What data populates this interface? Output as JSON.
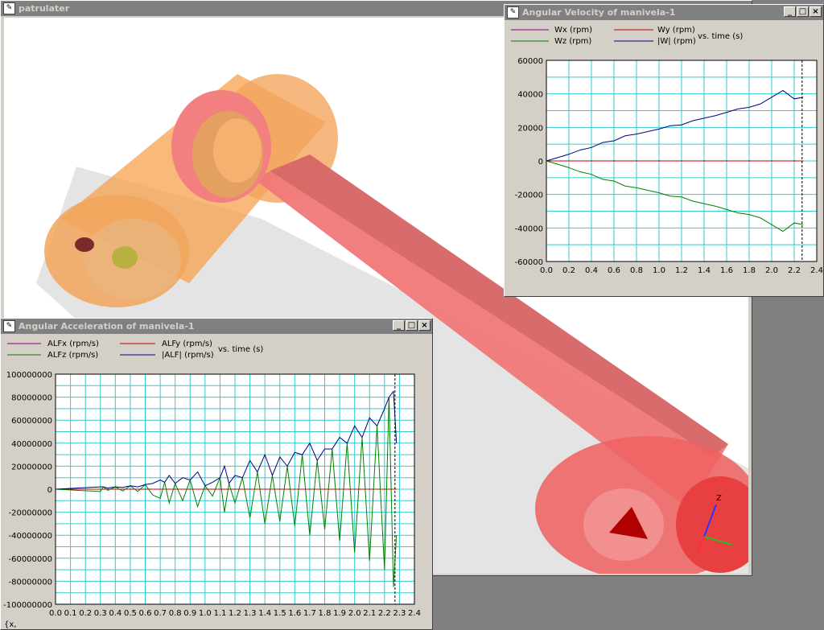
{
  "main_window": {
    "title": "patrulater"
  },
  "velocity_window": {
    "title": "Angular Velocity of manivela-1",
    "legend": [
      {
        "label": "Wx (rpm)",
        "color": "#800080"
      },
      {
        "label": "Wy (rpm)",
        "color": "#c00000"
      },
      {
        "label": "Wz (rpm)",
        "color": "#008000"
      },
      {
        "label": "|W| (rpm)",
        "color": "#000080"
      }
    ],
    "vs_label": "vs. time (s)"
  },
  "acceleration_window": {
    "title": "Angular Acceleration of manivela-1",
    "legend": [
      {
        "label": "ALFx (rpm/s)",
        "color": "#800080"
      },
      {
        "label": "ALFy (rpm/s)",
        "color": "#c00000"
      },
      {
        "label": "ALFz (rpm/s)",
        "color": "#008000"
      },
      {
        "label": "|ALF| (rpm/s)",
        "color": "#000080"
      }
    ],
    "vs_label": "vs. time (s)",
    "status": "{x,"
  },
  "window_buttons": {
    "minimize": "_",
    "maximize": "□",
    "close": "×"
  },
  "chart_data": [
    {
      "type": "line",
      "title": "Angular Velocity of manivela-1",
      "xlabel": "vs. time (s)",
      "xlim": [
        0.0,
        2.4
      ],
      "ylim": [
        -60000,
        60000
      ],
      "xticks": [
        "0.0",
        "0.2",
        "0.4",
        "0.6",
        "0.8",
        "1.0",
        "1.2",
        "1.4",
        "1.6",
        "1.8",
        "2.0",
        "2.2",
        "2.4"
      ],
      "yticks": [
        "60000",
        "40000",
        "20000",
        "0",
        "-20000",
        "-40000",
        "-60000"
      ],
      "cursor_x": 2.27,
      "x": [
        0.0,
        0.1,
        0.2,
        0.3,
        0.4,
        0.5,
        0.6,
        0.7,
        0.8,
        0.9,
        1.0,
        1.1,
        1.2,
        1.3,
        1.4,
        1.5,
        1.6,
        1.7,
        1.8,
        1.9,
        2.0,
        2.1,
        2.2,
        2.28
      ],
      "series": [
        {
          "name": "Wx (rpm)",
          "color": "#800080",
          "values": [
            0,
            0,
            0,
            0,
            0,
            0,
            0,
            0,
            0,
            0,
            0,
            0,
            0,
            0,
            0,
            0,
            0,
            0,
            0,
            0,
            0,
            0,
            0,
            0
          ]
        },
        {
          "name": "Wy (rpm)",
          "color": "#c00000",
          "values": [
            0,
            0,
            0,
            0,
            0,
            0,
            0,
            0,
            0,
            0,
            0,
            0,
            0,
            0,
            0,
            0,
            0,
            0,
            0,
            0,
            0,
            0,
            0,
            0
          ]
        },
        {
          "name": "Wz (rpm)",
          "color": "#008000",
          "values": [
            0,
            -2000,
            -4000,
            -6500,
            -8000,
            -11000,
            -12000,
            -15000,
            -16000,
            -17500,
            -19000,
            -21000,
            -21500,
            -24000,
            -25500,
            -27000,
            -29000,
            -31000,
            -32000,
            -34000,
            -38000,
            -42000,
            -37000,
            -38000
          ]
        },
        {
          "name": "|W| (rpm)",
          "color": "#000080",
          "values": [
            0,
            2000,
            4000,
            6500,
            8000,
            11000,
            12000,
            15000,
            16000,
            17500,
            19000,
            21000,
            21500,
            24000,
            25500,
            27000,
            29000,
            31000,
            32000,
            34000,
            38000,
            42000,
            37000,
            38000
          ]
        }
      ]
    },
    {
      "type": "line",
      "title": "Angular Acceleration of manivela-1",
      "xlabel": "vs. time (s)",
      "xlim": [
        0.0,
        2.4
      ],
      "ylim": [
        -100000000,
        100000000
      ],
      "xticks": [
        "0.0",
        "0.1",
        "0.2",
        "0.3",
        "0.4",
        "0.5",
        "0.6",
        "0.7",
        "0.8",
        "0.9",
        "1.0",
        "1.1",
        "1.2",
        "1.3",
        "1.4",
        "1.5",
        "1.6",
        "1.7",
        "1.8",
        "1.9",
        "2.0",
        "2.1",
        "2.2",
        "2.3",
        "2.4"
      ],
      "yticks": [
        "100000000",
        "80000000",
        "60000000",
        "40000000",
        "20000000",
        "0",
        "-20000000",
        "-40000000",
        "-60000000",
        "-80000000",
        "-100000000"
      ],
      "cursor_x": 2.27,
      "x": [
        0.0,
        0.3,
        0.32,
        0.35,
        0.4,
        0.45,
        0.5,
        0.55,
        0.6,
        0.65,
        0.7,
        0.73,
        0.76,
        0.8,
        0.85,
        0.9,
        0.95,
        1.0,
        1.05,
        1.1,
        1.13,
        1.16,
        1.2,
        1.25,
        1.3,
        1.35,
        1.4,
        1.45,
        1.5,
        1.55,
        1.6,
        1.65,
        1.7,
        1.75,
        1.8,
        1.85,
        1.9,
        1.95,
        2.0,
        2.05,
        2.1,
        2.15,
        2.2,
        2.23,
        2.26,
        2.28
      ],
      "series": [
        {
          "name": "ALFx (rpm/s)",
          "color": "#800080",
          "values": [
            0,
            0,
            0,
            0,
            0,
            0,
            0,
            0,
            0,
            0,
            0,
            0,
            0,
            0,
            0,
            0,
            0,
            0,
            0,
            0,
            0,
            0,
            0,
            0,
            0,
            0,
            0,
            0,
            0,
            0,
            0,
            0,
            0,
            0,
            0,
            0,
            0,
            0,
            0,
            0,
            0,
            0,
            0,
            0,
            0,
            0
          ]
        },
        {
          "name": "ALFy (rpm/s)",
          "color": "#c00000",
          "values": [
            0,
            0,
            0,
            0,
            0,
            0,
            0,
            0,
            0,
            0,
            0,
            0,
            0,
            0,
            0,
            0,
            0,
            0,
            0,
            0,
            0,
            0,
            0,
            0,
            0,
            0,
            0,
            0,
            0,
            0,
            0,
            0,
            0,
            0,
            0,
            0,
            0,
            0,
            0,
            0,
            0,
            0,
            0,
            0,
            0,
            0
          ]
        },
        {
          "name": "ALFz (rpm/s)",
          "color": "#008000",
          "values": [
            0,
            -2000000,
            2000000,
            -1000000,
            2000000,
            -1500000,
            3000000,
            -2000000,
            4000000,
            -5000000,
            -8000000,
            6000000,
            -12000000,
            5000000,
            -10000000,
            8000000,
            -15000000,
            3000000,
            -6000000,
            10000000,
            -20000000,
            5000000,
            -12000000,
            10000000,
            -25000000,
            15000000,
            -30000000,
            12000000,
            -28000000,
            20000000,
            -32000000,
            30000000,
            -40000000,
            25000000,
            -35000000,
            35000000,
            -45000000,
            40000000,
            -55000000,
            45000000,
            -62000000,
            55000000,
            -70000000,
            80000000,
            -85000000,
            -40000000
          ]
        },
        {
          "name": "|ALF| (rpm/s)",
          "color": "#000080",
          "values": [
            0,
            2000000,
            2000000,
            1000000,
            2000000,
            1500000,
            3000000,
            2000000,
            4000000,
            5000000,
            8000000,
            6000000,
            12000000,
            5000000,
            10000000,
            8000000,
            15000000,
            3000000,
            6000000,
            10000000,
            20000000,
            5000000,
            12000000,
            10000000,
            25000000,
            15000000,
            30000000,
            12000000,
            28000000,
            20000000,
            32000000,
            30000000,
            40000000,
            25000000,
            35000000,
            35000000,
            45000000,
            40000000,
            55000000,
            45000000,
            62000000,
            55000000,
            70000000,
            80000000,
            85000000,
            40000000
          ]
        }
      ]
    }
  ]
}
